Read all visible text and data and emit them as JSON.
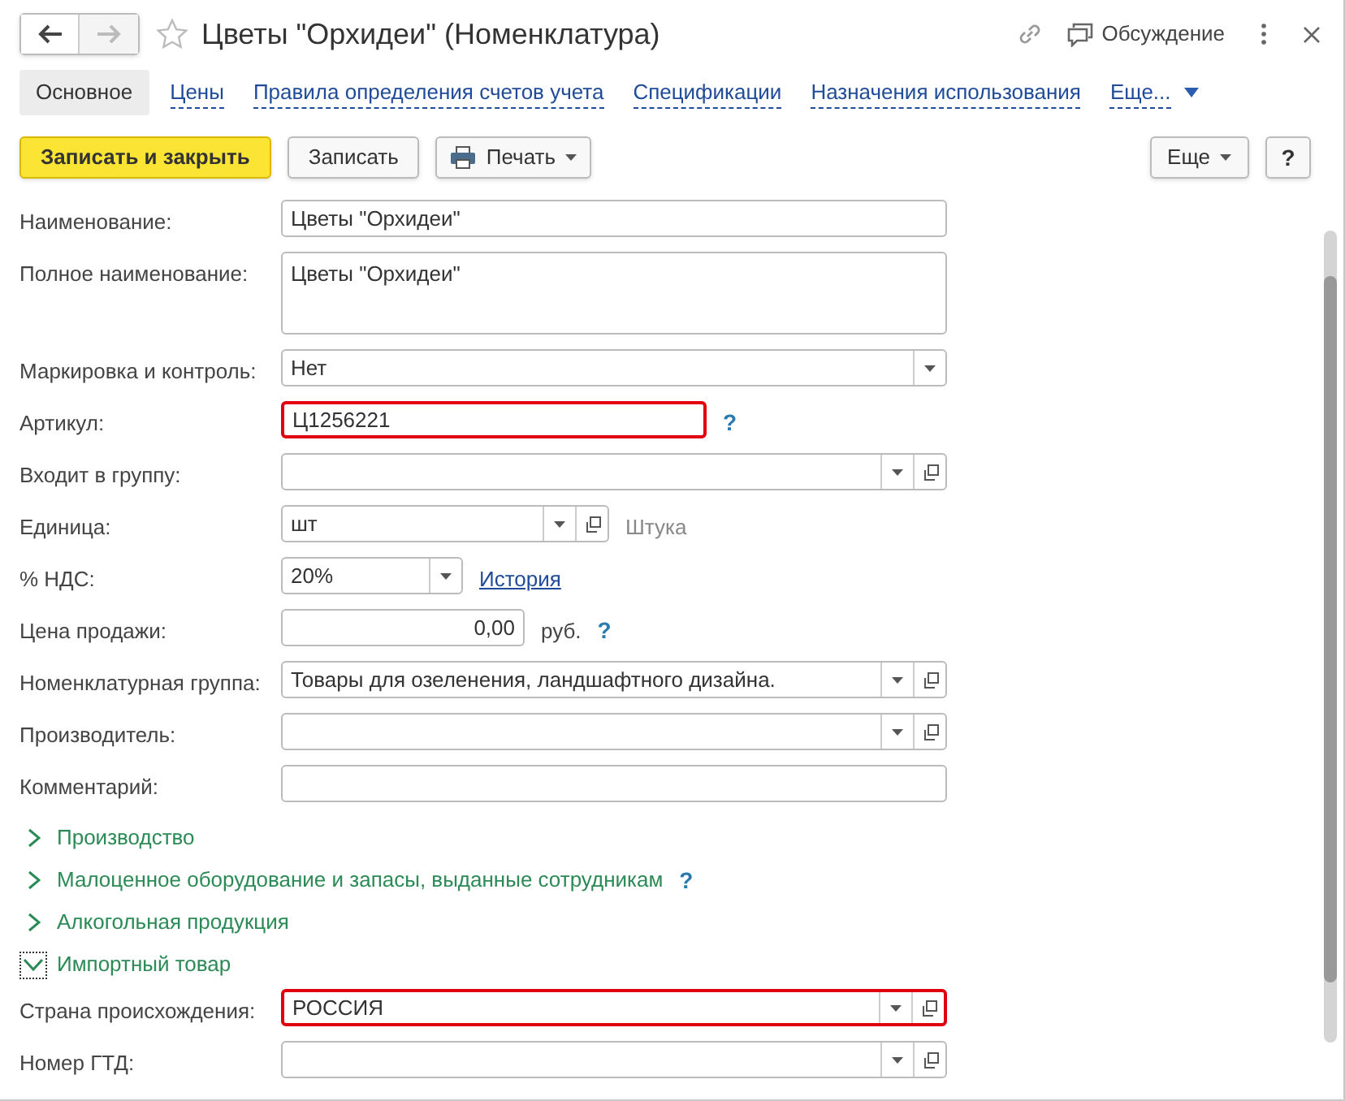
{
  "window": {
    "title": "Цветы \"Орхидеи\" (Номенклатура)",
    "discussion": "Обсуждение"
  },
  "tabs": [
    {
      "label": "Основное",
      "selected": true
    },
    {
      "label": "Цены",
      "selected": false
    },
    {
      "label": "Правила определения счетов учета",
      "selected": false
    },
    {
      "label": "Спецификации",
      "selected": false
    },
    {
      "label": "Назначения использования",
      "selected": false
    },
    {
      "label": "Еще...",
      "selected": false
    }
  ],
  "toolbar": {
    "buttons": [
      {
        "label": "Записать и закрыть",
        "kind": "primary"
      },
      {
        "label": "Записать",
        "kind": "plain"
      },
      {
        "label": "Печать",
        "kind": "print"
      }
    ],
    "more": "Еще",
    "help": "?"
  },
  "fields": [
    {
      "label": "Наименование:",
      "kind": "text",
      "value": "Цветы \"Орхидеи\"",
      "highlighted": false
    },
    {
      "label": "Полное наименование:",
      "kind": "textarea",
      "value": "Цветы \"Орхидеи\"",
      "highlighted": false
    },
    {
      "label": "Маркировка и контроль:",
      "kind": "select",
      "value": "Нет",
      "highlighted": false
    },
    {
      "label": "Артикул:",
      "kind": "short",
      "value": "Ц1256221",
      "highlighted": true,
      "help": "?"
    },
    {
      "label": "Входит в группу:",
      "kind": "select_open",
      "highlighted": false
    },
    {
      "label": "Единица:",
      "kind": "unit",
      "value": "шт",
      "highlighted": false,
      "note": "Штука"
    },
    {
      "label": "% НДС:",
      "kind": "vat",
      "value": "20%",
      "highlighted": false,
      "link": "История"
    },
    {
      "label": "Цена продажи:",
      "kind": "number",
      "value": "0,00",
      "highlighted": false,
      "note": "руб.",
      "help": "?"
    },
    {
      "label": "Номенклатурная группа:",
      "kind": "select_open",
      "value": "Товары для озеленения, ландшафтного дизайна.",
      "highlighted": false
    },
    {
      "label": "Производитель:",
      "kind": "select_open",
      "highlighted": false
    },
    {
      "label": "Комментарий:",
      "kind": "text",
      "highlighted": false
    }
  ],
  "sections": [
    {
      "label": "Производство",
      "expanded": false
    },
    {
      "label": "Малоценное оборудование и запасы, выданные сотрудникам",
      "expanded": false,
      "help": "?"
    },
    {
      "label": "Алкогольная продукция",
      "expanded": false
    },
    {
      "label": "Импортный товар",
      "expanded": true,
      "fields": [
        {
          "label": "Страна происхождения:",
          "kind": "select_open",
          "value": "РОССИЯ",
          "highlighted": true
        },
        {
          "label": "Номер ГТД:",
          "kind": "select_open",
          "highlighted": false
        }
      ]
    }
  ]
}
